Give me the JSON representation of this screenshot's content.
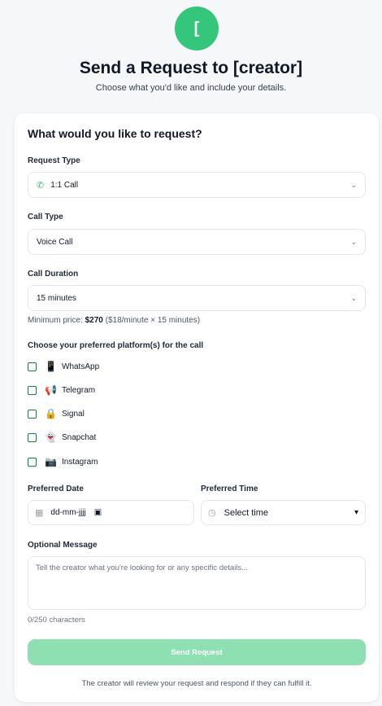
{
  "header": {
    "avatar_initial": "[",
    "title": "Send a Request to [creator]",
    "subtitle": "Choose what you'd like and include your details."
  },
  "form": {
    "section_title": "What would you like to request?",
    "request_type": {
      "label": "Request Type",
      "value": "1:1 Call",
      "icon": "phone-icon"
    },
    "call_type": {
      "label": "Call Type",
      "value": "Voice Call"
    },
    "call_duration": {
      "label": "Call Duration",
      "value": "15 minutes"
    },
    "min_price": {
      "prefix": "Minimum price:",
      "amount": "$270",
      "detail": "($18/minute × 15 minutes)"
    },
    "platforms": {
      "label": "Choose your preferred platform(s) for the call",
      "items": [
        {
          "emoji": "📱",
          "label": "WhatsApp",
          "checked": false
        },
        {
          "emoji": "📢",
          "label": "Telegram",
          "checked": false
        },
        {
          "emoji": "🔒",
          "label": "Signal",
          "checked": false
        },
        {
          "emoji": "👻",
          "label": "Snapchat",
          "checked": false
        },
        {
          "emoji": "📷",
          "label": "Instagram",
          "checked": false
        }
      ]
    },
    "preferred_date": {
      "label": "Preferred Date",
      "placeholder": "dd-mm-jjjj"
    },
    "preferred_time": {
      "label": "Preferred Time",
      "value": "Select time"
    },
    "message": {
      "label": "Optional Message",
      "placeholder": "Tell the creator what you're looking for or any specific details...",
      "char_count": "0/250 characters"
    },
    "submit_label": "Send Request",
    "footnote": "The creator will review your request and respond if they can fulfill it."
  },
  "colors": {
    "accent": "#34c77b",
    "button_disabled": "#8ee0b3",
    "checkbox_border": "#15803d",
    "background": "#f6f7f9"
  }
}
